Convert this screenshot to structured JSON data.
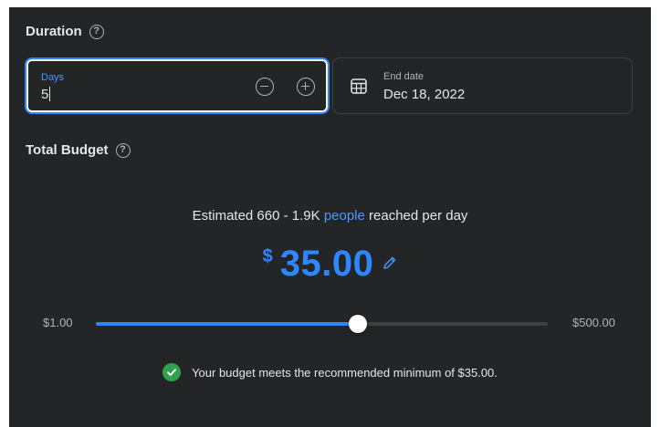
{
  "duration": {
    "title": "Duration",
    "days_label": "Days",
    "days_value": "5",
    "end_date_label": "End date",
    "end_date_value": "Dec 18, 2022"
  },
  "budget": {
    "title": "Total Budget",
    "estimate_prefix": "Estimated 660 - 1.9K ",
    "estimate_link": "people",
    "estimate_suffix": " reached per day",
    "currency_symbol": "$",
    "amount": "35.00",
    "slider_min_label": "$1.00",
    "slider_max_label": "$500.00",
    "slider_fraction": 0.58,
    "notice": "Your budget meets the recommended minimum of $35.00."
  },
  "icons": {
    "help": "help-circle-icon",
    "minus": "minus-circle-icon",
    "plus": "plus-circle-icon",
    "calendar": "calendar-icon",
    "edit": "pencil-icon",
    "success": "check-circle-icon"
  },
  "colors": {
    "panel": "#242526",
    "accent": "#2d88ff",
    "link": "#4599ff",
    "success": "#31a24c",
    "text": "#e4e6eb",
    "muted": "#b0b3b8"
  }
}
